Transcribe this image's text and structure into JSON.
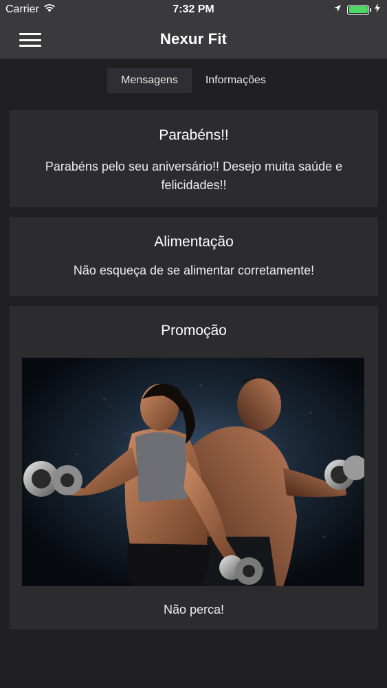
{
  "status_bar": {
    "carrier": "Carrier",
    "time": "7:32 PM",
    "battery_level": 1.0,
    "battery_color": "#4cd964"
  },
  "nav": {
    "title": "Nexur Fit",
    "menu_icon": "hamburger-menu-icon"
  },
  "tabs": [
    {
      "label": "Mensagens",
      "active": true
    },
    {
      "label": "Informações",
      "active": false
    }
  ],
  "messages": [
    {
      "title": "Parabéns!!",
      "text": "Parabéns pelo seu aniversário!! Desejo muita saúde e felicidades!!"
    },
    {
      "title": "Alimentação",
      "text": "Não esqueça de se alimentar corretamente!"
    },
    {
      "title": "Promoção",
      "image": "fitness-couple-dumbbells-image",
      "text": "Não perca!"
    }
  ],
  "colors": {
    "background": "#202023",
    "bar": "#3a3a3c",
    "card": "#2c2c2f"
  }
}
